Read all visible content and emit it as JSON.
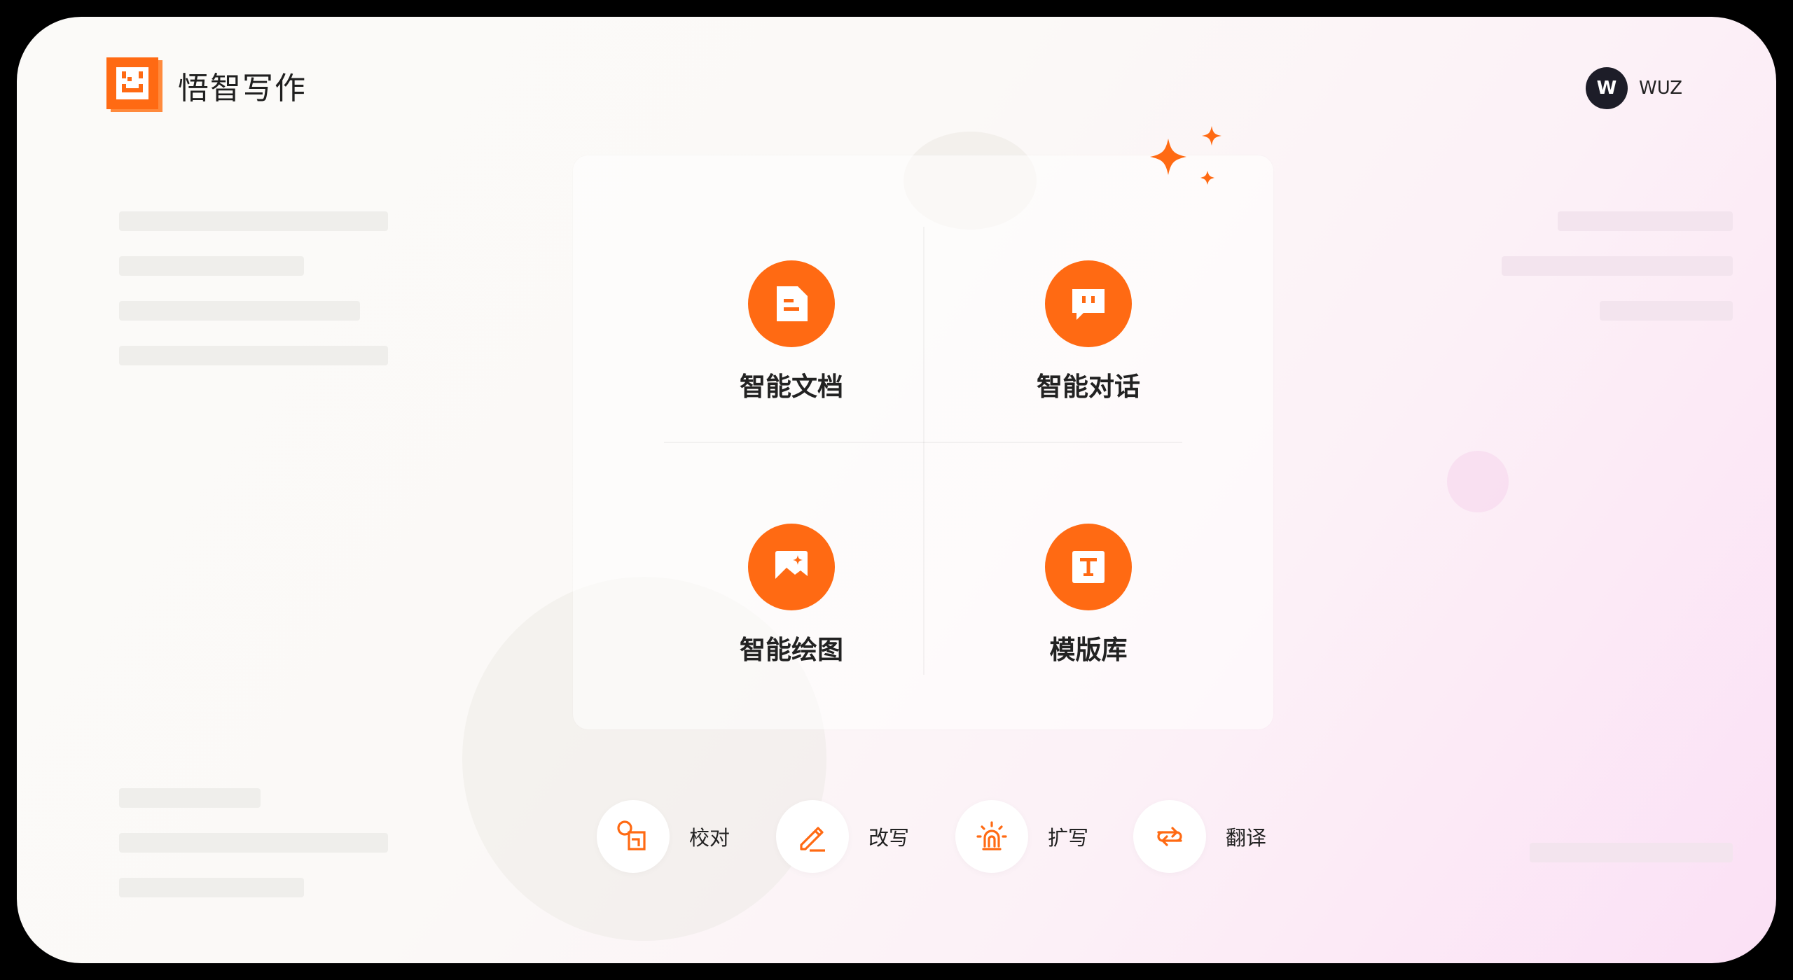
{
  "brand": {
    "name": "悟智写作",
    "logo_icon": "smiley-box-logo"
  },
  "user": {
    "avatar_letter": "W",
    "name": "WUZ"
  },
  "features": [
    {
      "label": "智能文档",
      "icon": "document-icon"
    },
    {
      "label": "智能对话",
      "icon": "chat-icon"
    },
    {
      "label": "智能绘图",
      "icon": "image-icon"
    },
    {
      "label": "模版库",
      "icon": "text-template-icon"
    }
  ],
  "tools": [
    {
      "label": "校对",
      "icon": "proofread-icon"
    },
    {
      "label": "改写",
      "icon": "pen-icon"
    },
    {
      "label": "扩写",
      "icon": "expand-icon"
    },
    {
      "label": "翻译",
      "icon": "translate-icon"
    }
  ],
  "colors": {
    "accent": "#ff6a13",
    "avatar_bg": "#1d1d28",
    "text": "#222222"
  }
}
